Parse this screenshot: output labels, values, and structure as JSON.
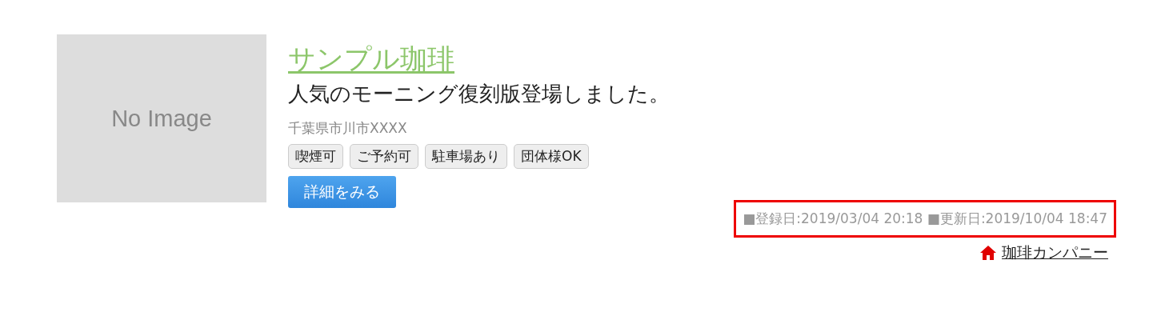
{
  "thumbnail": {
    "text": "No Image"
  },
  "title": "サンプル珈琲",
  "catch": "人気のモーニング復刻版登場しました。",
  "address": "千葉県市川市XXXX",
  "tags": [
    "喫煙可",
    "ご予約可",
    "駐車場あり",
    "団体様OK"
  ],
  "detail_button": "詳細をみる",
  "dates": "■登録日:2019/03/04 20:18 ■更新日:2019/10/04 18:47",
  "company_link": "珈琲カンパニー"
}
